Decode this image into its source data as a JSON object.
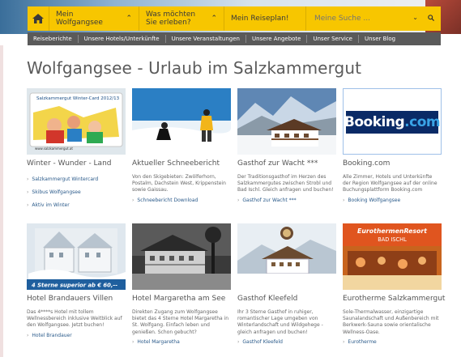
{
  "nav": {
    "items": [
      {
        "label": "Mein Wolfgangsee"
      },
      {
        "label": "Was möchten Sie erleben?"
      },
      {
        "label": "Mein Reiseplan!"
      }
    ],
    "search": {
      "placeholder": "Meine Suche ..."
    }
  },
  "subnav": [
    "Reiseberichte",
    "Unsere Hotels/Unterkünfte",
    "Unsere Veranstaltungen",
    "Unsere Angebote",
    "Unser Service",
    "Unser Blog"
  ],
  "page_title": "Wolfgangsee - Urlaub im Salzkammergut",
  "cards": [
    {
      "title": "Winter - Wunder - Land",
      "image_text": "Salzkammergut Winter-Card 2012/13",
      "image_url": "www.salzkammergut.at",
      "desc": "",
      "links": [
        "Salzkammergut Wintercard",
        "Skibus Wolfgangsee",
        "Aktiv im Winter"
      ]
    },
    {
      "title": "Aktueller Schneebericht",
      "desc": "Von den Skigebieten: Zwölferhorn, Postalm, Dachstein West, Krippenstein sowie Gaissau.",
      "links": [
        "Schneebericht Download"
      ]
    },
    {
      "title": "Gasthof zur Wacht ***",
      "desc": "Der Traditionsgasthof im Herzen des Salzkammergutes zwischen Strobl und Bad Ischl. Gleich anfragen und buchen!",
      "links": [
        "Gasthof zur Wacht ***"
      ]
    },
    {
      "title": "Booking.com",
      "image_text_a": "Booking",
      "image_text_b": ".com",
      "desc": "Alle Zimmer, Hotels und Unterkünfte der Region Wolfgangsee auf der online Buchungsplattform Booking.com",
      "links": [
        "Booking Wolfgangsee"
      ]
    },
    {
      "title": "Hotel Brandauers Villen",
      "image_text": "4 Sterne superior ab € 60,--",
      "desc": "Das 4****s Hotel mit tollem Wellnessbereich inklusive Weitblick auf den Wolfgangsee. Jetzt buchen!",
      "links": [
        "Hotel Brandauer"
      ]
    },
    {
      "title": "Hotel Margaretha am See",
      "desc": "Direkten Zugang zum Wolfgangsee bietet das 4 Sterne Hotel Margaretha in St. Wolfgang. Einfach leben und genießen. Schon gebucht?",
      "links": [
        "Hotel Margaretha"
      ]
    },
    {
      "title": "Gasthof Kleefeld",
      "desc": "Ihr 3 Sterne Gasthof in ruhiger, romantischer Lage umgeben von Winterlandschaft und Wildgehege - gleich anfragen und buchen!",
      "links": [
        "Gasthof Kleefeld"
      ]
    },
    {
      "title": "Eurotherme Salzkammergut",
      "image_text_a": "EurothermenResort",
      "image_text_b": "BAD ISCHL",
      "desc": "Sole-Thermalwasser, einzigartige Saunalandschaft und Außenbereich mit Berkwerk-Sauna sowie orientalische Wellness-Oase.",
      "links": [
        "Eurotherme"
      ]
    }
  ],
  "colors": {
    "nav_yellow": "#f7c600",
    "subnav_gray": "#5a5a5a",
    "link_blue": "#2a5a8a",
    "booking_blue": "#0a2a66",
    "eurotherm_orange": "#e0551f"
  }
}
